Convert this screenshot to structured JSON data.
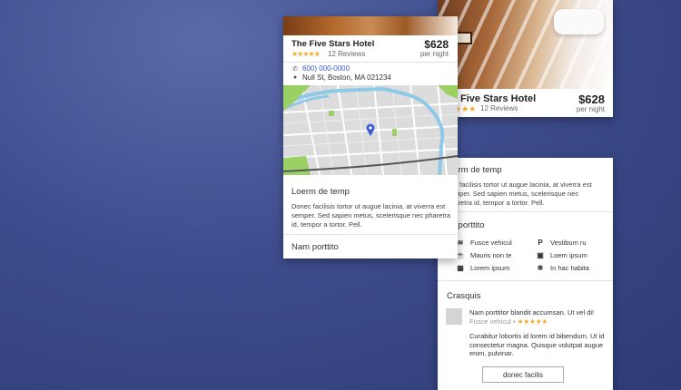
{
  "back_card_top": {
    "title": "Five Stars Hotel",
    "stars": "★★★",
    "reviews": "12 Reviews",
    "price": "$628",
    "per_night": "per night"
  },
  "back_card_bottom": {
    "section1_title": "oerm de temp",
    "section1_text": "nec facilisis tortor ut augue lacinia, at viverra est semper. Sed sapien metus, scelerisque nec pharetra id, tempor a tortor. Pell.",
    "section2_title": "m porttito",
    "amenities": [
      {
        "icon": "wifi-icon",
        "glyph": "≋",
        "label": "Fusce vehicul"
      },
      {
        "icon": "parking-icon",
        "glyph": "P",
        "label": "Vestibum ru"
      },
      {
        "icon": "coffee-icon",
        "glyph": "☕",
        "label": "Mauris non te"
      },
      {
        "icon": "briefcase-icon",
        "glyph": "▣",
        "label": "Loem ipsum"
      },
      {
        "icon": "safe-icon",
        "glyph": "▦",
        "label": "Lorem ipsum"
      },
      {
        "icon": "snowflake-icon",
        "glyph": "❄",
        "label": "In hac habita"
      }
    ],
    "section3_title": "Crasquis",
    "review_text": "Nam porttitor blandit accumsan. Ut vel di!",
    "review_author": "Fusce vehicul",
    "review_stars": "★★★★★",
    "review_body": "Curabitur lobortis id lorem id bibendum. Ut id consectetur magna. Quisque volutpat augue enim, pulvinar.",
    "button_label": "donec facilis"
  },
  "front_card": {
    "title": "The Five Stars Hotel",
    "stars": "★★★★★",
    "reviews": "12 Reviews",
    "price": "$628",
    "per_night": "per night",
    "phone": "600) 000-0000",
    "address": "Null St, Boston, MA 021234",
    "section1_title": "Loerm de temp",
    "section1_text": "Donec facilisis tortor ut augue lacinia, at viverra est semper. Sed sapien metus, scelerisque nec pharetra id, tempor a tortor. Pell.",
    "section2_title": "Nam porttito"
  },
  "colors": {
    "star": "#f5a623",
    "link": "#3b59c8",
    "map_marker": "#3b5bd0",
    "map_water": "#8fc9e8",
    "map_park": "#9bd064"
  }
}
